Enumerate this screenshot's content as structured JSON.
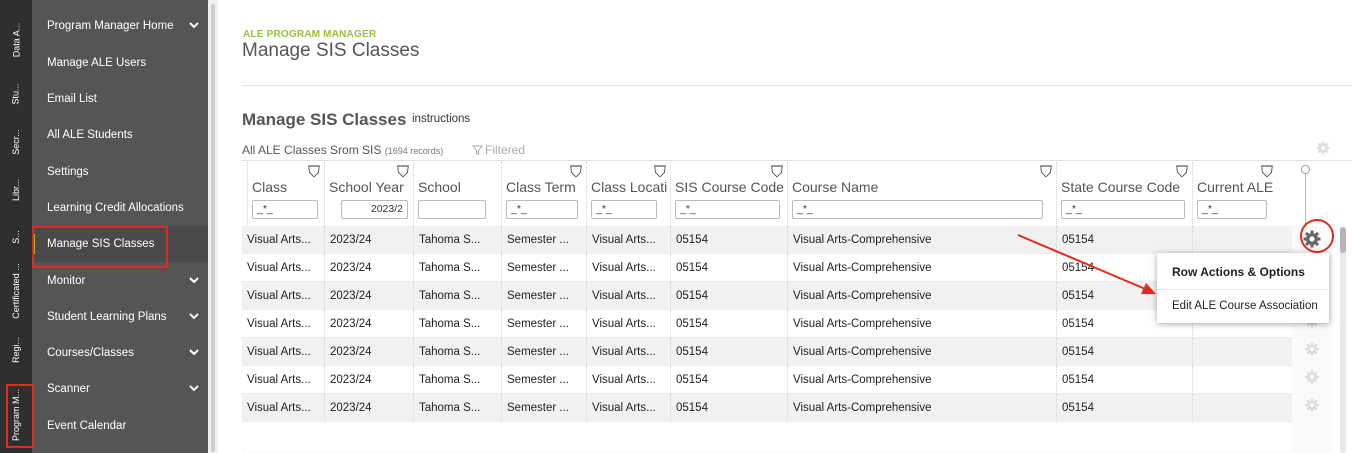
{
  "vertical_tabs": [
    "Data A...",
    "Stu...",
    "Secr...",
    "Libr...",
    "S...",
    "Certificated ...",
    "Regi...",
    "Program M..."
  ],
  "sidebar": {
    "items": [
      {
        "label": "Program Manager Home",
        "chevron": true
      },
      {
        "label": "Manage ALE Users",
        "chevron": false
      },
      {
        "label": "Email List",
        "chevron": false
      },
      {
        "label": "All ALE Students",
        "chevron": false
      },
      {
        "label": "Settings",
        "chevron": false
      },
      {
        "label": "Learning Credit Allocations",
        "chevron": false
      },
      {
        "label": "Manage SIS Classes",
        "chevron": false,
        "active": true
      },
      {
        "label": "Monitor",
        "chevron": true
      },
      {
        "label": "Student Learning Plans",
        "chevron": true
      },
      {
        "label": "Courses/Classes",
        "chevron": true
      },
      {
        "label": "Scanner",
        "chevron": true
      },
      {
        "label": "Event Calendar",
        "chevron": false
      }
    ]
  },
  "header": {
    "app_label": "ALE PROGRAM MANAGER",
    "page_title": "Manage SIS Classes"
  },
  "section": {
    "title": "Manage SIS Classes",
    "instructions_link": "instructions"
  },
  "grid": {
    "caption": "All ALE Classes Srom SIS",
    "record_count": "(1694 records)",
    "filter_status": "Filtered",
    "columns": [
      {
        "label": "Class",
        "filter": "_*_"
      },
      {
        "label": "School Year",
        "filter": "2023/2"
      },
      {
        "label": "School",
        "filter": ""
      },
      {
        "label": "Class Term",
        "filter": "_*_"
      },
      {
        "label": "Class Location",
        "filter": "_*_"
      },
      {
        "label": "SIS Course Code",
        "filter": "_*_"
      },
      {
        "label": "Course Name",
        "filter": "_*_"
      },
      {
        "label": "State Course Code",
        "filter": "_*_"
      },
      {
        "label": "Current ALE",
        "filter": "_*_"
      }
    ],
    "rows": [
      [
        "Visual Arts...",
        "2023/24",
        "Tahoma S...",
        "Semester ...",
        "Visual Arts...",
        "05154",
        "Visual Arts-Comprehensive",
        "05154",
        ""
      ],
      [
        "Visual Arts...",
        "2023/24",
        "Tahoma S...",
        "Semester ...",
        "Visual Arts...",
        "05154",
        "Visual Arts-Comprehensive",
        "05154",
        ""
      ],
      [
        "Visual Arts...",
        "2023/24",
        "Tahoma S...",
        "Semester ...",
        "Visual Arts...",
        "05154",
        "Visual Arts-Comprehensive",
        "05154",
        ""
      ],
      [
        "Visual Arts...",
        "2023/24",
        "Tahoma S...",
        "Semester ...",
        "Visual Arts...",
        "05154",
        "Visual Arts-Comprehensive",
        "05154",
        ""
      ],
      [
        "Visual Arts...",
        "2023/24",
        "Tahoma S...",
        "Semester ...",
        "Visual Arts...",
        "05154",
        "Visual Arts-Comprehensive",
        "05154",
        ""
      ],
      [
        "Visual Arts...",
        "2023/24",
        "Tahoma S...",
        "Semester ...",
        "Visual Arts...",
        "05154",
        "Visual Arts-Comprehensive",
        "05154",
        ""
      ],
      [
        "Visual Arts...",
        "2023/24",
        "Tahoma S...",
        "Semester ...",
        "Visual Arts...",
        "05154",
        "Visual Arts-Comprehensive",
        "05154",
        ""
      ]
    ]
  },
  "row_menu": {
    "title": "Row Actions & Options",
    "items": [
      "Edit ALE Course Association"
    ]
  },
  "colors": {
    "accent": "#9ac13b",
    "sidebar_bg": "#555555",
    "annotation_red": "#e02b20"
  }
}
